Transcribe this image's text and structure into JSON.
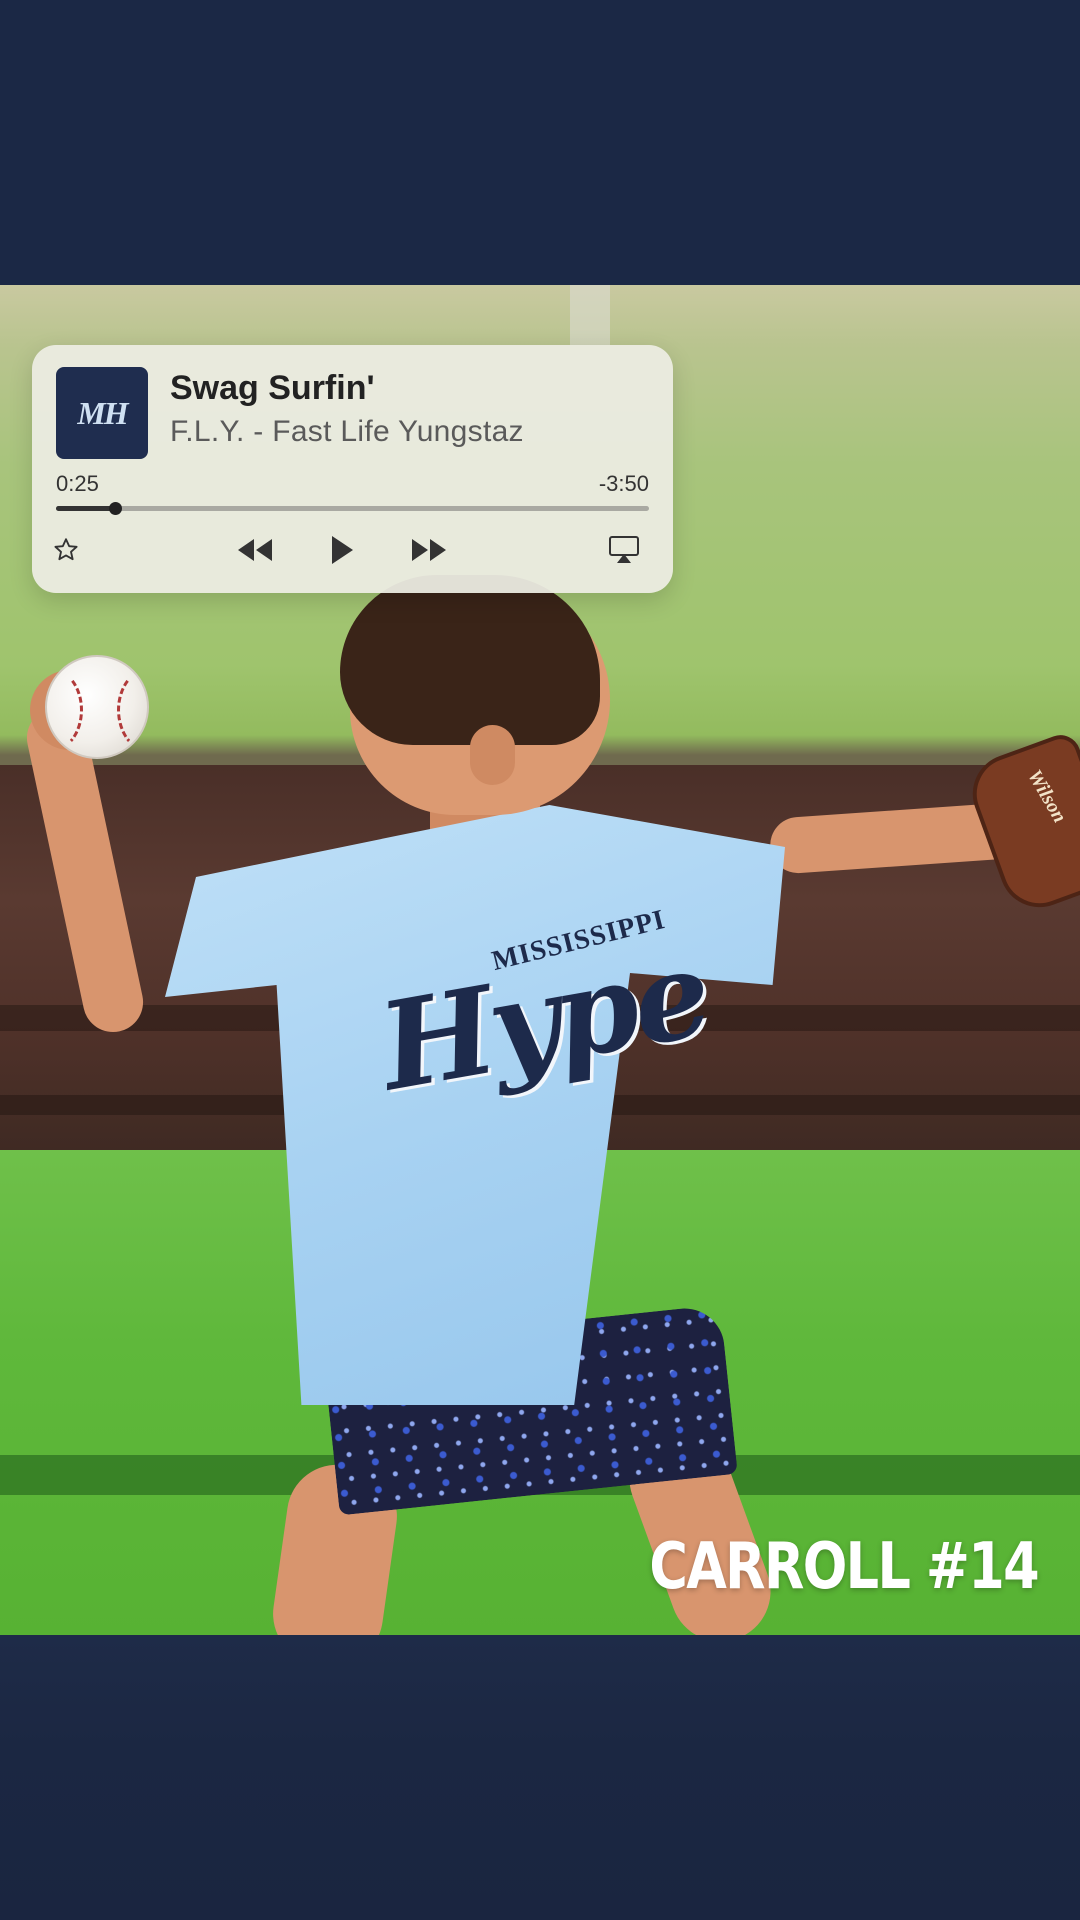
{
  "now_playing": {
    "album_art_text": "MH",
    "title": "Swag Surfin'",
    "artist": "F.L.Y. - Fast Life Yungstaz",
    "elapsed": "0:25",
    "remaining": "-3:50",
    "progress_fraction": 0.1,
    "controls": {
      "favorite": "star-icon",
      "rewind": "rewind-icon",
      "play": "play-icon",
      "fast_forward": "fast-forward-icon",
      "airplay": "airplay-icon"
    }
  },
  "photo": {
    "caption": "CARROLL #14",
    "shirt_small_text": "MISSISSIPPI",
    "shirt_big_text": "Hype",
    "glove_brand": "Wilson"
  },
  "colors": {
    "background": "#1b2845",
    "widget": "#ecece2"
  }
}
